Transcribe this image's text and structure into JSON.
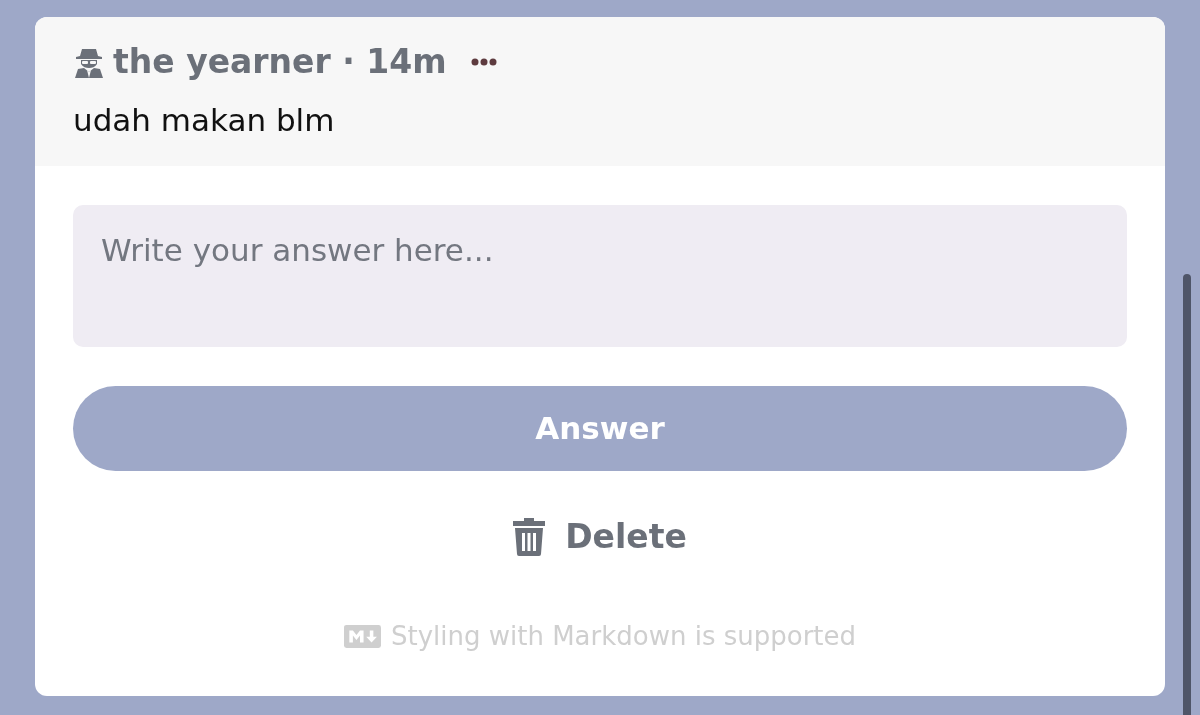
{
  "post": {
    "byline": "the yearner · 14m",
    "message": "udah makan blm"
  },
  "answer": {
    "placeholder": "Write your answer here..."
  },
  "buttons": [
    {
      "kind": "primary",
      "label": "Answer"
    },
    {
      "kind": "delete",
      "label": "Delete"
    }
  ],
  "footer": {
    "note": "Styling with Markdown is supported"
  }
}
